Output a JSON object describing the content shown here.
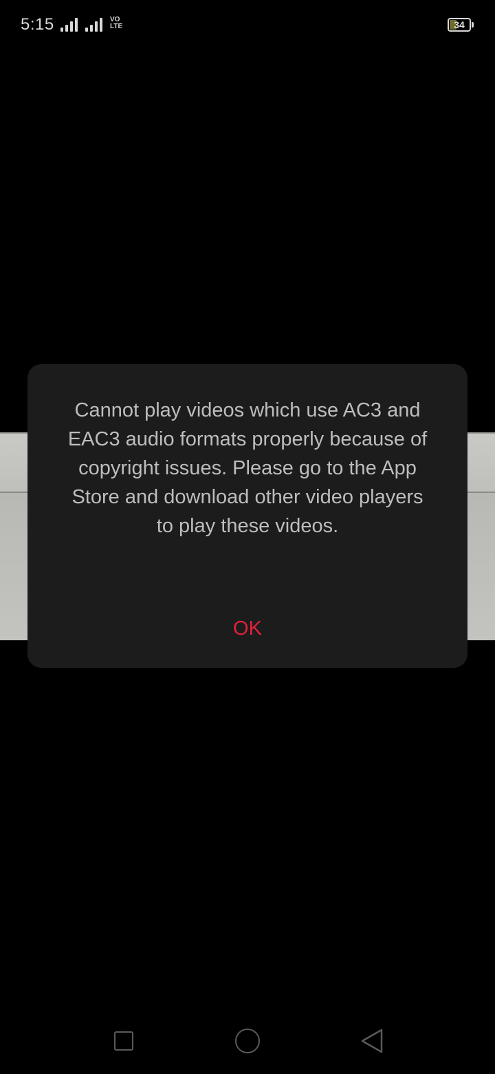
{
  "status_bar": {
    "time": "5:15",
    "network_badge": "VoLTE",
    "battery_level": "34",
    "icons": [
      "signal-icon",
      "signal-icon",
      "volte-icon",
      "battery-icon"
    ]
  },
  "dialog": {
    "message": "Cannot play videos which use AC3 and EAC3 audio formats properly because of copyright issues. Please go to the App Store and download other video players to play these videos.",
    "ok_label": "OK",
    "accent_color": "#e0213b"
  },
  "nav_bar": {
    "icons": [
      "recent-apps-icon",
      "home-icon",
      "back-icon"
    ]
  }
}
